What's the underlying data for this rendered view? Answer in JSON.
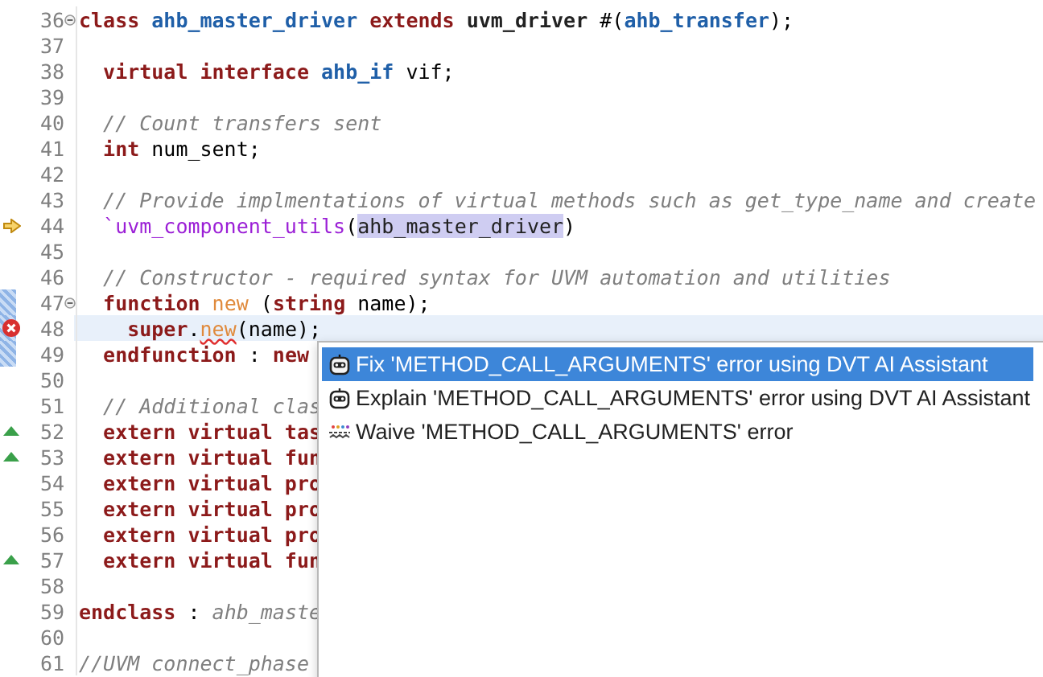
{
  "editor": {
    "lines": [
      {
        "number": "36",
        "fold": {
          "expanded": true
        },
        "current": false,
        "changed": false,
        "tokens": [
          {
            "kind": "kw",
            "text": "class "
          },
          {
            "kind": "type",
            "text": "ahb_master_driver "
          },
          {
            "kind": "kw",
            "text": "extends "
          },
          {
            "kind": "bold",
            "text": "uvm_driver "
          },
          {
            "kind": "plain",
            "text": "#("
          },
          {
            "kind": "type",
            "text": "ahb_transfer"
          },
          {
            "kind": "plain",
            "text": ");"
          }
        ]
      },
      {
        "number": "37",
        "current": false,
        "changed": false
      },
      {
        "number": "38",
        "current": false,
        "changed": false,
        "tokens": [
          {
            "kind": "kw",
            "text": "  virtual interface "
          },
          {
            "kind": "type",
            "text": "ahb_if "
          },
          {
            "kind": "plain",
            "text": "vif;"
          }
        ]
      },
      {
        "number": "39",
        "current": false,
        "changed": false
      },
      {
        "number": "40",
        "current": false,
        "changed": false,
        "tokens": [
          {
            "kind": "comment",
            "text": "  // Count transfers sent"
          }
        ]
      },
      {
        "number": "41",
        "current": false,
        "changed": false,
        "tokens": [
          {
            "kind": "kw",
            "text": "  int "
          },
          {
            "kind": "plain",
            "text": "num_sent;"
          }
        ]
      },
      {
        "number": "42",
        "current": false,
        "changed": false
      },
      {
        "number": "43",
        "current": false,
        "changed": false,
        "tokens": [
          {
            "kind": "comment",
            "text": "  // Provide implmentations of virtual methods such as get_type_name and create"
          }
        ]
      },
      {
        "number": "44",
        "marker": {
          "kind": "arrow"
        },
        "current": false,
        "changed": false,
        "tokens": [
          {
            "kind": "macro",
            "text": "  `uvm_component_utils"
          },
          {
            "kind": "plain",
            "text": "("
          },
          {
            "kind": "highlight",
            "text": "ahb_master_driver"
          },
          {
            "kind": "plain",
            "text": ")"
          }
        ]
      },
      {
        "number": "45",
        "current": false,
        "changed": false
      },
      {
        "number": "46",
        "current": false,
        "changed": false,
        "tokens": [
          {
            "kind": "comment",
            "text": "  // Constructor - required syntax for UVM automation and utilities"
          }
        ]
      },
      {
        "number": "47",
        "fold": {
          "expanded": true
        },
        "current": false,
        "changed": true,
        "tokens": [
          {
            "kind": "kw",
            "text": "  function "
          },
          {
            "kind": "call",
            "text": "new "
          },
          {
            "kind": "plain",
            "text": "("
          },
          {
            "kind": "kw",
            "text": "string "
          },
          {
            "kind": "plain",
            "text": "name);"
          }
        ]
      },
      {
        "number": "48",
        "marker": {
          "kind": "error"
        },
        "current": true,
        "changed": true,
        "tokens": [
          {
            "kind": "kw",
            "text": "    super"
          },
          {
            "kind": "plain",
            "text": "."
          },
          {
            "kind": "error",
            "text": "new"
          },
          {
            "kind": "plain",
            "text": "(name);"
          }
        ]
      },
      {
        "number": "49",
        "current": false,
        "changed": true,
        "tokens": [
          {
            "kind": "kw",
            "text": "  endfunction "
          },
          {
            "kind": "plain",
            "text": ": "
          },
          {
            "kind": "kw",
            "text": "new"
          }
        ]
      },
      {
        "number": "50",
        "current": false,
        "changed": false
      },
      {
        "number": "51",
        "current": false,
        "changed": false,
        "tokens": [
          {
            "kind": "comment",
            "text": "  // Additional clas"
          }
        ]
      },
      {
        "number": "52",
        "marker": {
          "kind": "up"
        },
        "current": false,
        "changed": false,
        "tokens": [
          {
            "kind": "kw",
            "text": "  extern virtual tas"
          }
        ]
      },
      {
        "number": "53",
        "marker": {
          "kind": "up"
        },
        "current": false,
        "changed": false,
        "tokens": [
          {
            "kind": "kw",
            "text": "  extern virtual fun"
          }
        ]
      },
      {
        "number": "54",
        "current": false,
        "changed": false,
        "tokens": [
          {
            "kind": "kw",
            "text": "  extern virtual pro"
          }
        ]
      },
      {
        "number": "55",
        "current": false,
        "changed": false,
        "tokens": [
          {
            "kind": "kw",
            "text": "  extern virtual pro"
          }
        ]
      },
      {
        "number": "56",
        "current": false,
        "changed": false,
        "tokens": [
          {
            "kind": "kw",
            "text": "  extern virtual pro"
          }
        ]
      },
      {
        "number": "57",
        "marker": {
          "kind": "up"
        },
        "current": false,
        "changed": false,
        "tokens": [
          {
            "kind": "kw",
            "text": "  extern virtual fun"
          }
        ]
      },
      {
        "number": "58",
        "current": false,
        "changed": false
      },
      {
        "number": "59",
        "current": false,
        "changed": false,
        "tokens": [
          {
            "kind": "kw",
            "text": "endclass "
          },
          {
            "kind": "plain",
            "text": ": "
          },
          {
            "kind": "comment",
            "text": "ahb_maste"
          }
        ]
      },
      {
        "number": "60",
        "current": false,
        "changed": false
      },
      {
        "number": "61",
        "current": false,
        "changed": false,
        "tokens": [
          {
            "kind": "comment",
            "text": "//UVM connect_phase"
          }
        ]
      }
    ]
  },
  "quick_fix_menu": {
    "items": [
      {
        "kind": "robot",
        "label": "Fix 'METHOD_CALL_ARGUMENTS' error using DVT AI Assistant",
        "selected": true
      },
      {
        "kind": "robot",
        "label": "Explain 'METHOD_CALL_ARGUMENTS' error using DVT AI Assistant",
        "selected": false
      },
      {
        "kind": "waive",
        "label": "Waive 'METHOD_CALL_ARGUMENTS' error",
        "selected": false
      }
    ]
  }
}
